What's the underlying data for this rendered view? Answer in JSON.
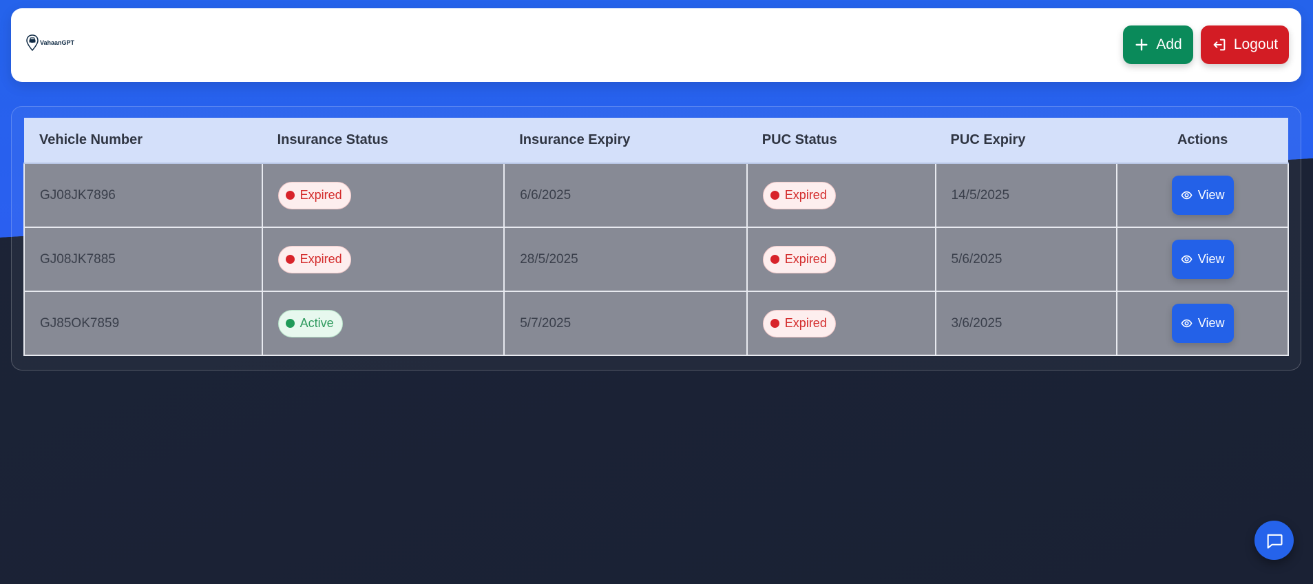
{
  "brand": {
    "name": "VahaanGPT",
    "icon": "car-location-pin-icon"
  },
  "header": {
    "add_label": "Add",
    "logout_label": "Logout",
    "add_icon": "plus-icon",
    "logout_icon": "logout-icon",
    "colors": {
      "add": "#0a8a5a",
      "logout": "#d31c24"
    }
  },
  "table": {
    "columns": [
      "Vehicle Number",
      "Insurance Status",
      "Insurance Expiry",
      "PUC Status",
      "PUC Expiry",
      "Actions"
    ],
    "rows": [
      {
        "vehicle_number": "GJ08JK7896",
        "insurance_status": "Expired",
        "insurance_expiry": "6/6/2025",
        "puc_status": "Expired",
        "puc_expiry": "14/5/2025",
        "action": "View"
      },
      {
        "vehicle_number": "GJ08JK7885",
        "insurance_status": "Expired",
        "insurance_expiry": "28/5/2025",
        "puc_status": "Expired",
        "puc_expiry": "5/6/2025",
        "action": "View"
      },
      {
        "vehicle_number": "GJ85OK7859",
        "insurance_status": "Active",
        "insurance_expiry": "5/7/2025",
        "puc_status": "Expired",
        "puc_expiry": "3/6/2025",
        "action": "View"
      }
    ],
    "status_colors": {
      "Expired": "#d8232a",
      "Active": "#1f9a58"
    },
    "view_icon": "eye-icon"
  },
  "chat": {
    "icon": "chat-bubble-icon"
  }
}
